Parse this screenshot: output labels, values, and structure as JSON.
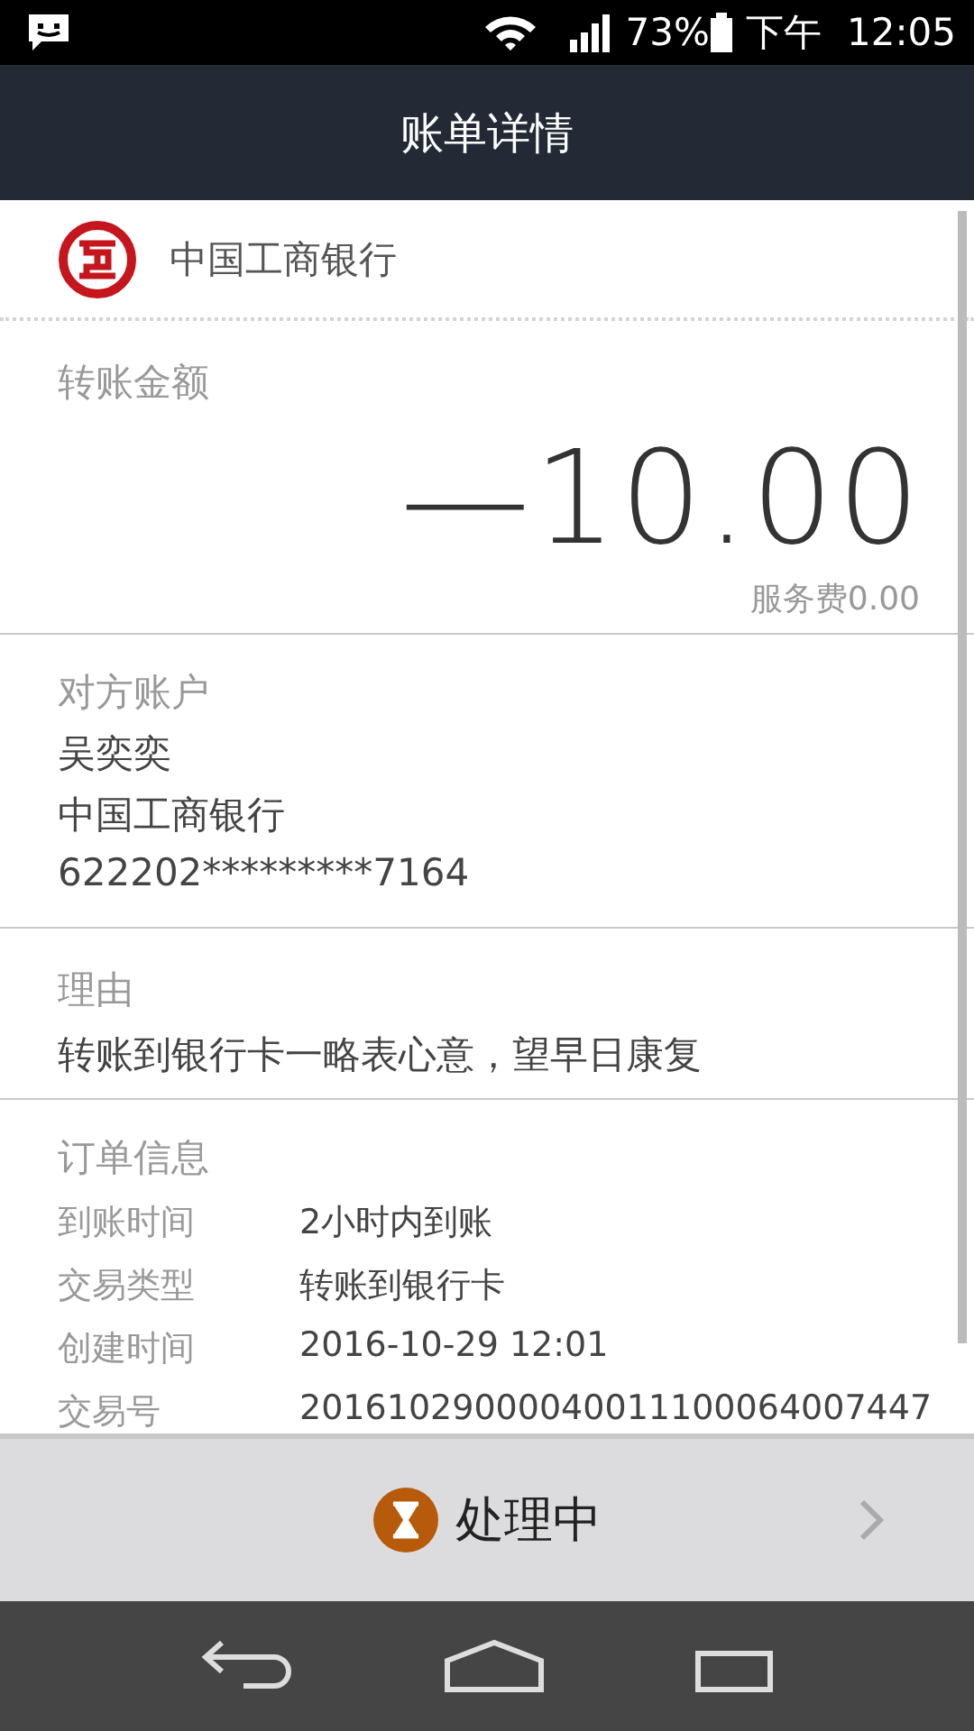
{
  "status_bar": {
    "battery": "73%",
    "period": "下午",
    "time": "12:05"
  },
  "header": {
    "title": "账单详情"
  },
  "bank": {
    "name": "中国工商银行"
  },
  "amount": {
    "label": "转账金额",
    "value": "—10.00",
    "fee": "服务费0.00"
  },
  "counterparty": {
    "label": "对方账户",
    "lines": [
      "吴奕奕",
      "中国工商银行",
      "622202*********7164"
    ]
  },
  "reason": {
    "label": "理由",
    "text": "转账到银行卡一略表心意，望早日康复"
  },
  "order": {
    "label": "订单信息",
    "rows": [
      {
        "key": "到账时间",
        "value": "2小时内到账"
      },
      {
        "key": "交易类型",
        "value": "转账到银行卡"
      },
      {
        "key": "创建时间",
        "value": "2016-10-29 12:01"
      },
      {
        "key": "交易号",
        "value": "20161029000040011100064007447"
      }
    ]
  },
  "footer": {
    "status": "处理中"
  }
}
